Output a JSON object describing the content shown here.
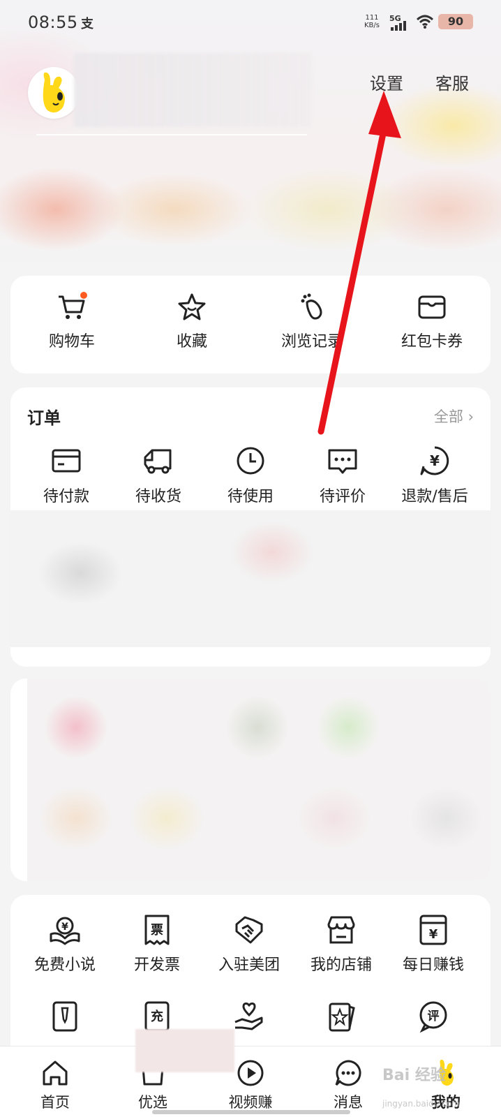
{
  "status_bar": {
    "time": "08:55",
    "time_extra": "支",
    "net_speed_value": "111",
    "net_speed_unit": "KB/s",
    "signal": "5G",
    "battery": "90"
  },
  "header": {
    "settings_label": "设置",
    "service_label": "客服"
  },
  "quick_actions": [
    {
      "label": "购物车",
      "icon": "cart-icon"
    },
    {
      "label": "收藏",
      "icon": "star-icon"
    },
    {
      "label": "浏览记录",
      "icon": "footprint-icon"
    },
    {
      "label": "红包卡券",
      "icon": "wallet-icon"
    }
  ],
  "orders": {
    "title": "订单",
    "all_label": "全部 ›",
    "items": [
      {
        "label": "待付款",
        "icon": "card-icon"
      },
      {
        "label": "待收货",
        "icon": "truck-icon"
      },
      {
        "label": "待使用",
        "icon": "clock-icon"
      },
      {
        "label": "待评价",
        "icon": "comment-icon"
      },
      {
        "label": "退款/售后",
        "icon": "refund-icon"
      }
    ]
  },
  "tools": {
    "row1": [
      {
        "label": "免费小说",
        "icon": "book-icon"
      },
      {
        "label": "开发票",
        "icon": "invoice-icon"
      },
      {
        "label": "入驻美团",
        "icon": "handshake-icon"
      },
      {
        "label": "我的店铺",
        "icon": "store-icon"
      },
      {
        "label": "每日赚钱",
        "icon": "money-icon"
      }
    ],
    "row2_glyphs": {
      "recharge": "充",
      "review": "评"
    }
  },
  "bottom_nav": [
    {
      "label": "首页",
      "icon": "home-icon"
    },
    {
      "label": "优选",
      "icon": "bag-icon"
    },
    {
      "label": "视频赚",
      "icon": "play-icon"
    },
    {
      "label": "消息",
      "icon": "message-icon"
    },
    {
      "label": "我的",
      "icon": "mine-icon"
    }
  ],
  "watermark": {
    "text": "Bai 经验",
    "sub": "jingyan.baidu.com"
  },
  "colors": {
    "accent": "#ff5a1f",
    "arrow": "#e8141c",
    "mascot": "#ffd81a"
  }
}
